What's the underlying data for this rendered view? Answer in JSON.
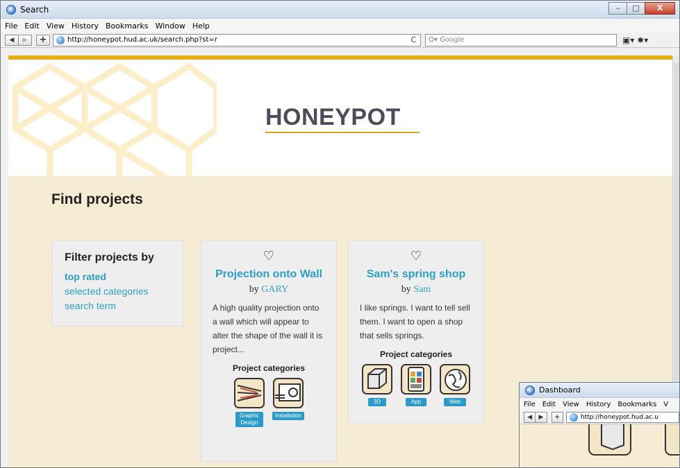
{
  "window": {
    "title": "Search",
    "min": "–",
    "max": "□",
    "close": "X"
  },
  "menu": [
    "File",
    "Edit",
    "View",
    "History",
    "Bookmarks",
    "Window",
    "Help"
  ],
  "nav": {
    "back": "◀",
    "forward": "▶",
    "add": "+",
    "url": "http://honeypot.hud.ac.uk/search.php?st=r",
    "reload": "C",
    "search_placeholder": "Q▾ Google"
  },
  "page": {
    "brand": "HONEYPOT",
    "heading": "Find projects",
    "filter": {
      "title": "Filter projects by",
      "links": [
        "top rated",
        "selected categories",
        "search term"
      ]
    },
    "projects": [
      {
        "title": "Projection onto Wall",
        "by": "by",
        "author": "GARY",
        "description": "A high quality projection onto a wall which will appear to alter the shape of the wall it is project...",
        "categories_label": "Project categories",
        "categories": [
          {
            "name": "Graphic Design"
          },
          {
            "name": "Installation"
          }
        ]
      },
      {
        "title": "Sam's spring shop",
        "by": "by",
        "author": "Sam",
        "description": "I like springs. I want to tell sell them. I want to open a shop that sells springs.",
        "categories_label": "Project categories",
        "categories": [
          {
            "name": "3D"
          },
          {
            "name": "App"
          },
          {
            "name": "Web"
          }
        ]
      }
    ]
  },
  "second_window": {
    "title": "Dashboard",
    "menu": [
      "File",
      "Edit",
      "View",
      "History",
      "Bookmarks",
      "V"
    ],
    "url": "http://honeypot.hud.ac.u"
  },
  "colors": {
    "accent": "#2aa0c8",
    "gold": "#e6ad1a",
    "page_bg": "#f6ecd4"
  }
}
